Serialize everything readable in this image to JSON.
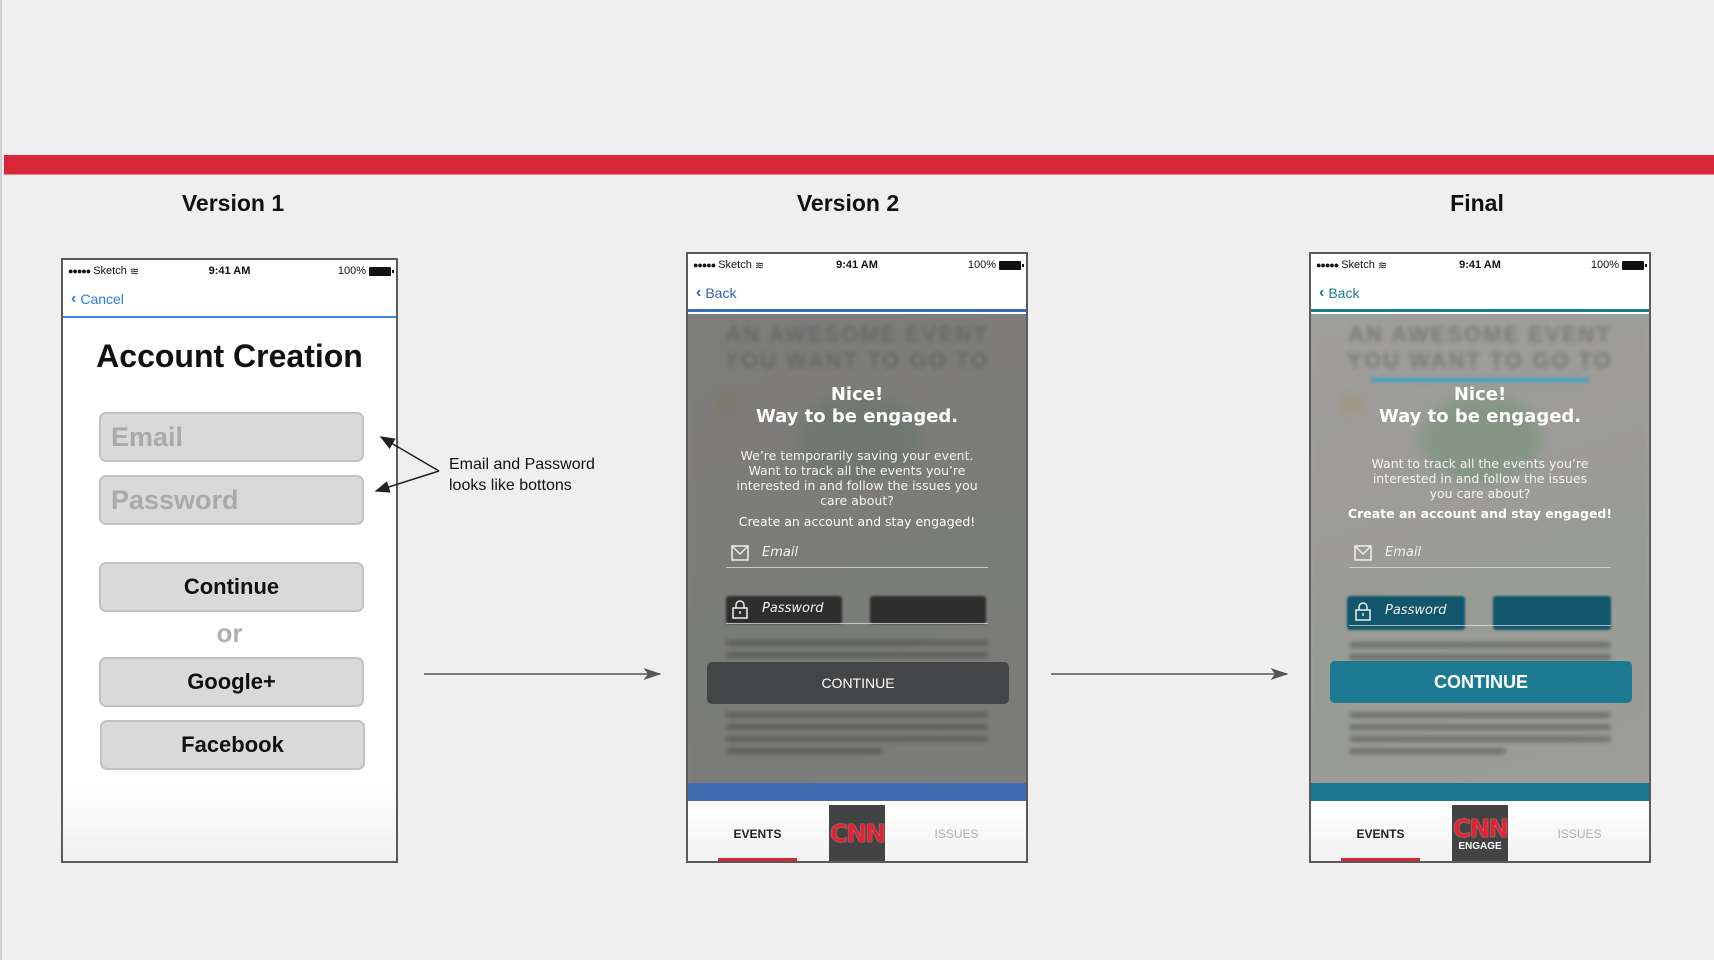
{
  "titles": {
    "v1": "Version 1",
    "v2": "Version 2",
    "final": "Final"
  },
  "status_bar": {
    "carrier": "Sketch",
    "signal_dots": "●●●●●",
    "time": "9:41 AM",
    "battery": "100%"
  },
  "version1": {
    "nav_back": "Cancel",
    "heading": "Account Creation",
    "email_placeholder": "Email",
    "password_placeholder": "Password",
    "continue_label": "Continue",
    "or_label": "or",
    "google_label": "Google+",
    "facebook_label": "Facebook"
  },
  "annotation": {
    "line1": "Email and Password",
    "line2": "looks like bottons"
  },
  "version2": {
    "nav_back": "Back",
    "blurred_heading_1": "AN AWESOME EVENT",
    "blurred_heading_2": "YOU WANT TO GO TO",
    "nice_line1": "Nice!",
    "nice_line2": "Way to be engaged.",
    "message": "We’re temporarily saving your event. Want to track all the events you’re interested in and follow the issues you care about?",
    "cta": "Create an account and stay engaged!",
    "email_placeholder": "Email",
    "password_placeholder": "Password",
    "continue_label": "CONTINUE",
    "tab_events": "EVENTS",
    "tab_issues": "ISSUES",
    "logo_text": "CNN",
    "accent": "#3d6db3"
  },
  "final": {
    "nav_back": "Back",
    "blurred_heading_1": "AN AWESOME EVENT",
    "blurred_heading_2": "YOU WANT TO GO TO",
    "nice_line1": "Nice!",
    "nice_line2": "Way to be engaged.",
    "message": "Want to track all the events you’re interested in and follow the issues you care about?",
    "cta": "Create an account and stay engaged!",
    "email_placeholder": "Email",
    "password_placeholder": "Password",
    "continue_label": "CONTINUE",
    "tab_events": "EVENTS",
    "tab_issues": "ISSUES",
    "logo_text": "CNN",
    "logo_sub": "ENGAGE",
    "accent": "#1c7b93"
  },
  "colors": {
    "brand_red": "#d72737",
    "background": "#efefef"
  }
}
